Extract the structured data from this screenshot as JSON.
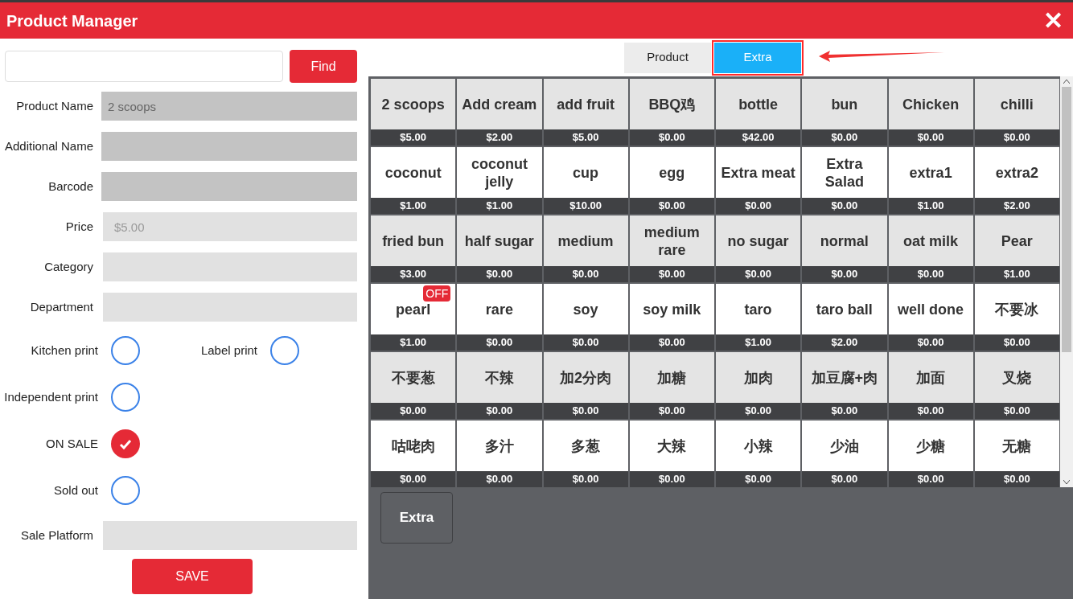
{
  "window": {
    "title": "Product Manager",
    "close": "✕"
  },
  "search": {
    "button": "Find"
  },
  "fields": [
    {
      "label": "Product Name",
      "value": "2 scoops",
      "disabled": true
    },
    {
      "label": "Additional Name",
      "disabled": true
    },
    {
      "label": "Barcode",
      "disabled": true
    },
    {
      "label": "Price",
      "value": "$5.00",
      "disabled": false
    },
    {
      "label": "Category",
      "disabled": false
    },
    {
      "label": "Department",
      "disabled": false
    }
  ],
  "toggle_rows": [
    [
      {
        "label": "Kitchen print",
        "checked": false
      },
      {
        "label": "Label print",
        "checked": false
      }
    ],
    [
      {
        "label": "Independent print",
        "checked": false
      }
    ],
    [
      {
        "label": "ON SALE",
        "checked": true
      }
    ],
    [
      {
        "label": "Sold out",
        "checked": false
      }
    ]
  ],
  "platform_field": {
    "label": "Sale Platform"
  },
  "save_button": "SAVE",
  "tabs": [
    {
      "label": "Product",
      "selected": false
    },
    {
      "label": "Extra",
      "selected": true
    }
  ],
  "items": [
    {
      "name": "2 scoops",
      "price": "$5.00"
    },
    {
      "name": "Add cream",
      "price": "$2.00"
    },
    {
      "name": "add fruit",
      "price": "$5.00"
    },
    {
      "name": "BBQ鸡",
      "price": "$0.00"
    },
    {
      "name": "bottle",
      "price": "$42.00"
    },
    {
      "name": "bun",
      "price": "$0.00"
    },
    {
      "name": "Chicken",
      "price": "$0.00"
    },
    {
      "name": "chilli",
      "price": "$0.00"
    },
    {
      "name": "coconut",
      "price": "$1.00"
    },
    {
      "name": "coconut jelly",
      "price": "$1.00"
    },
    {
      "name": "cup",
      "price": "$10.00"
    },
    {
      "name": "egg",
      "price": "$0.00"
    },
    {
      "name": "Extra meat",
      "price": "$0.00"
    },
    {
      "name": "Extra Salad",
      "price": "$0.00"
    },
    {
      "name": "extra1",
      "price": "$1.00"
    },
    {
      "name": "extra2",
      "price": "$2.00"
    },
    {
      "name": "fried bun",
      "price": "$3.00"
    },
    {
      "name": "half sugar",
      "price": "$0.00"
    },
    {
      "name": "medium",
      "price": "$0.00"
    },
    {
      "name": "medium rare",
      "price": "$0.00"
    },
    {
      "name": "no sugar",
      "price": "$0.00"
    },
    {
      "name": "normal",
      "price": "$0.00"
    },
    {
      "name": "oat milk",
      "price": "$0.00"
    },
    {
      "name": "Pear",
      "price": "$1.00"
    },
    {
      "name": "pearl",
      "price": "$1.00",
      "badge": "OFF"
    },
    {
      "name": "rare",
      "price": "$0.00"
    },
    {
      "name": "soy",
      "price": "$0.00"
    },
    {
      "name": "soy milk",
      "price": "$0.00"
    },
    {
      "name": "taro",
      "price": "$1.00"
    },
    {
      "name": "taro ball",
      "price": "$2.00"
    },
    {
      "name": "well done",
      "price": "$0.00"
    },
    {
      "name": "不要冰",
      "price": "$0.00"
    },
    {
      "name": "不要葱",
      "price": "$0.00"
    },
    {
      "name": "不辣",
      "price": "$0.00"
    },
    {
      "name": "加2分肉",
      "price": "$0.00"
    },
    {
      "name": "加糖",
      "price": "$0.00"
    },
    {
      "name": "加肉",
      "price": "$0.00"
    },
    {
      "name": "加豆腐+肉",
      "price": "$0.00"
    },
    {
      "name": "加面",
      "price": "$0.00"
    },
    {
      "name": "叉烧",
      "price": "$0.00"
    },
    {
      "name": "咕咾肉",
      "price": "$0.00"
    },
    {
      "name": "多汁",
      "price": "$0.00"
    },
    {
      "name": "多葱",
      "price": "$0.00"
    },
    {
      "name": "大辣",
      "price": "$0.00"
    },
    {
      "name": "小辣",
      "price": "$0.00"
    },
    {
      "name": "少油",
      "price": "$0.00"
    },
    {
      "name": "少糖",
      "price": "$0.00"
    },
    {
      "name": "无糖",
      "price": "$0.00"
    }
  ],
  "categories": [
    {
      "label": "Extra"
    }
  ]
}
